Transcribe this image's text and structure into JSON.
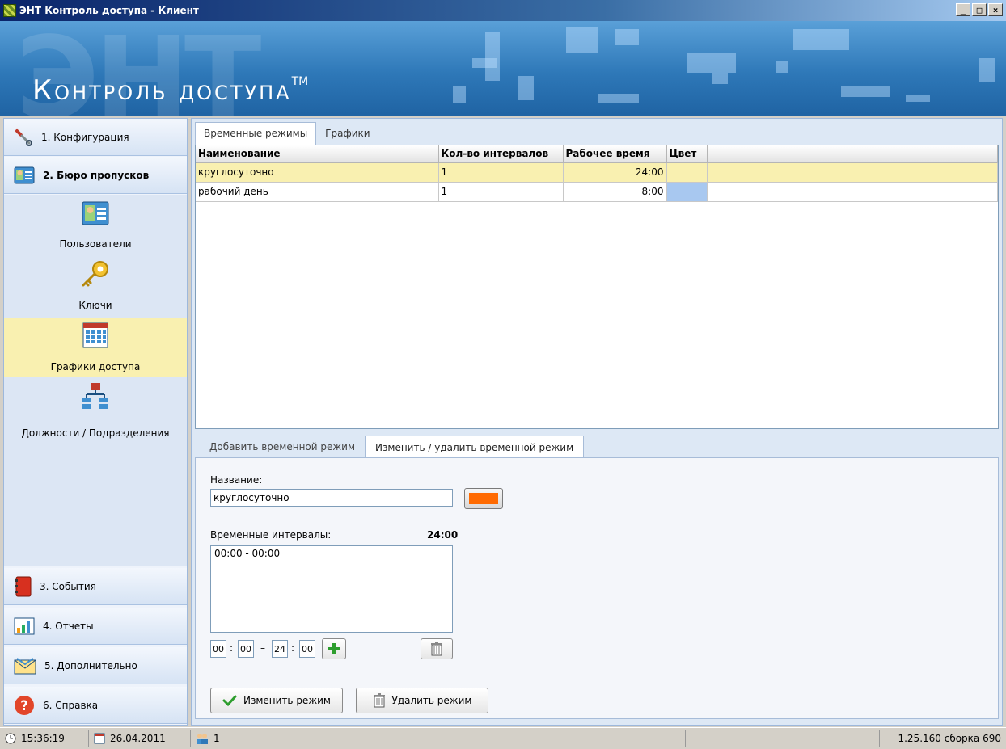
{
  "window": {
    "title": "ЭНТ Контроль доступа - Клиент",
    "controls": [
      "_",
      "□",
      "×"
    ]
  },
  "banner": {
    "brand": "Контроль доступа",
    "trademark": "TM"
  },
  "sidebar": {
    "items": [
      {
        "label": "1. Конфигурация",
        "icon": "wrench-icon"
      },
      {
        "label": "2. Бюро пропусков",
        "icon": "id-card-icon"
      },
      {
        "label": "3. События",
        "icon": "journal-icon"
      },
      {
        "label": "4. Отчеты",
        "icon": "bar-chart-icon"
      },
      {
        "label": "5. Дополнительно",
        "icon": "envelope-icon"
      },
      {
        "label": "6. Справка",
        "icon": "help-icon"
      }
    ],
    "subitems": [
      {
        "label": "Пользователи",
        "icon": "user-card-icon"
      },
      {
        "label": "Ключи",
        "icon": "key-icon"
      },
      {
        "label": "Графики доступа",
        "icon": "calendar-icon"
      },
      {
        "label": "Должности / Подразделения",
        "icon": "org-chart-icon"
      }
    ]
  },
  "main": {
    "tabs": [
      "Временные режимы",
      "Графики"
    ],
    "grid": {
      "columns": [
        "Наименование",
        "Кол-во интервалов",
        "Рабочее время",
        "Цвет"
      ],
      "rows": [
        {
          "name": "круглосуточно",
          "count": "1",
          "time": "24:00",
          "color": "#f9f0b0"
        },
        {
          "name": "рабочий день",
          "count": "1",
          "time": "8:00",
          "color": "#a8c8f0"
        }
      ]
    },
    "subtabs": [
      "Добавить временной режим",
      "Изменить / удалить временной режим"
    ],
    "form": {
      "name_label": "Название:",
      "name_value": "круглосуточно",
      "color": "#ff6a00",
      "intervals_label": "Временные интервалы:",
      "intervals_total": "24:00",
      "intervals": [
        "00:00 - 00:00"
      ],
      "from_h": "00",
      "from_m": "00",
      "to_h": "24",
      "to_m": "00",
      "colon": ":",
      "dash": "–",
      "edit_button": "Изменить режим",
      "delete_button": "Удалить режим"
    }
  },
  "status": {
    "time": "15:36:19",
    "date": "26.04.2011",
    "users": "1",
    "version": "1.25.160 сборка 690"
  }
}
